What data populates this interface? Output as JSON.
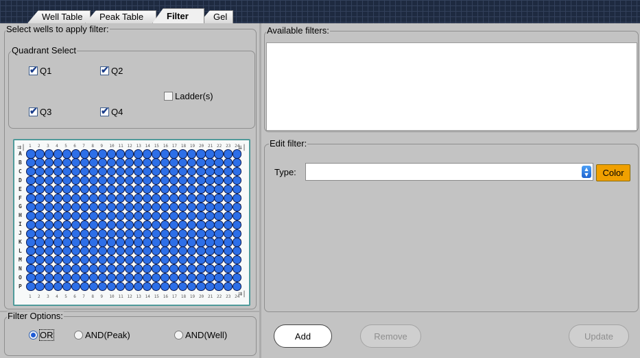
{
  "tabs": [
    {
      "label": "Well Table",
      "active": false
    },
    {
      "label": "Peak Table",
      "active": false
    },
    {
      "label": "Filter",
      "active": true
    },
    {
      "label": "Gel",
      "active": false
    }
  ],
  "select_wells": {
    "title": "Select wells to apply filter:",
    "quadrant": {
      "title": "Quadrant Select",
      "items": [
        {
          "label": "Q1",
          "checked": true
        },
        {
          "label": "Q2",
          "checked": true
        },
        {
          "label": "Q3",
          "checked": true
        },
        {
          "label": "Q4",
          "checked": true
        }
      ],
      "ladder": {
        "label": "Ladder(s)",
        "checked": false
      }
    },
    "plate": {
      "rows": [
        "A",
        "B",
        "C",
        "D",
        "E",
        "F",
        "G",
        "H",
        "I",
        "J",
        "K",
        "L",
        "M",
        "N",
        "O",
        "P"
      ],
      "columns": 24,
      "well_color": "#2d6fe8"
    }
  },
  "filter_options": {
    "title": "Filter Options:",
    "options": [
      {
        "label": "OR",
        "selected": true
      },
      {
        "label": "AND(Peak)",
        "selected": false
      },
      {
        "label": "AND(Well)",
        "selected": false
      }
    ]
  },
  "available_filters": {
    "title": "Available filters:",
    "items": []
  },
  "edit_filter": {
    "title": "Edit filter:",
    "type_label": "Type:",
    "type_value": "",
    "color_button": "Color",
    "color_button_bg": "#f0a000"
  },
  "actions": {
    "add": "Add",
    "remove": "Remove",
    "update": "Update"
  }
}
